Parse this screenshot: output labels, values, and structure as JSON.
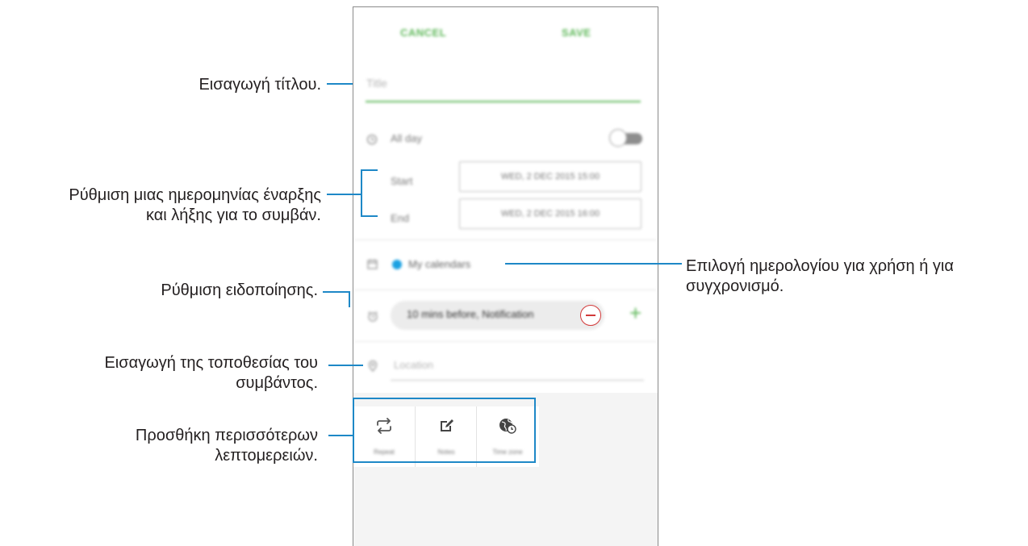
{
  "annotations": {
    "title": "Εισαγωγή τίτλου.",
    "dates_line1": "Ρύθμιση μιας ημερομηνίας έναρξης",
    "dates_line2": "και λήξης για το συμβάν.",
    "calendar_line1": "Επιλογή ημερολογίου για χρήση ή για",
    "calendar_line2": "συγχρονισμό.",
    "reminder": "Ρύθμιση ειδοποίησης.",
    "location_line1": "Εισαγωγή της τοποθεσίας του",
    "location_line2": "συμβάντος.",
    "more_line1": "Προσθήκη περισσότερων",
    "more_line2": "λεπτομερειών."
  },
  "app": {
    "cancel_label": "CANCEL",
    "save_label": "SAVE",
    "title_placeholder": "Title",
    "all_day_label": "All day",
    "all_day_on": false,
    "start_label": "Start",
    "start_value": "WED, 2 DEC 2015 15:00",
    "end_label": "End",
    "end_value": "WED, 2 DEC 2015 16:00",
    "calendar_name": "My calendars",
    "calendar_color": "#1ba1e2",
    "reminder_value": "10 mins before, Notification",
    "location_placeholder": "Location",
    "accent_color": "#5fb85a",
    "more": {
      "repeat_label": "Repeat",
      "notes_label": "Notes",
      "timezone_label": "Time zone"
    }
  }
}
